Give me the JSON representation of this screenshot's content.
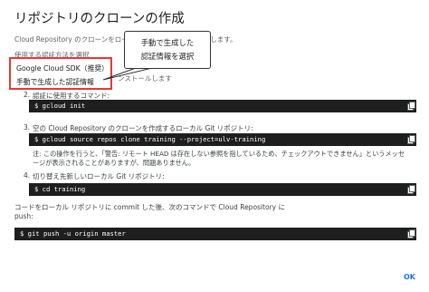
{
  "dialog": {
    "title": "リポジトリのクローンの作成",
    "intro_line": "Cloud Repository のクローンをローカル Git リポジトリに作成します。",
    "method_label": "使用する認証方法を選択",
    "behind_text": "ンストールします"
  },
  "auth_dropdown": {
    "options": [
      {
        "label": "Google Cloud SDK（推奨）"
      },
      {
        "label": "手動で生成した認証情報"
      }
    ]
  },
  "callout": {
    "line1": "手動で生成した",
    "line2": "認証情報を選択"
  },
  "steps": [
    {
      "num": "2.",
      "text": "認証に使用するコマンド:"
    },
    {
      "num": "3.",
      "text": "空の Cloud Repository のクローンを作成するローカル Git リポジトリ:"
    },
    {
      "num": "4.",
      "text": "切り替え先新しいローカル Git リポジトリ:"
    }
  ],
  "commands": {
    "gcloud_init": "$ gcloud init",
    "clone": "$ gcloud source repos clone training --project=ulv-training",
    "cd": "$ cd training",
    "push": "$ git push -u origin master"
  },
  "note": "注: この操作を行うと、「警告: リモート HEAD は存在しない参照を指しているため、チェックアウトできません」というメッセージが表示されることがありますが、問題ありません。",
  "push_text": "コードをローカル リポジトリに commit した後、次のコマンドで Cloud Repository に push:",
  "footer": {
    "ok_label": "OK",
    "accent_color": "#1a73e8"
  },
  "icons": {
    "copy": "copy-icon"
  },
  "highlight_color": "#e53935"
}
